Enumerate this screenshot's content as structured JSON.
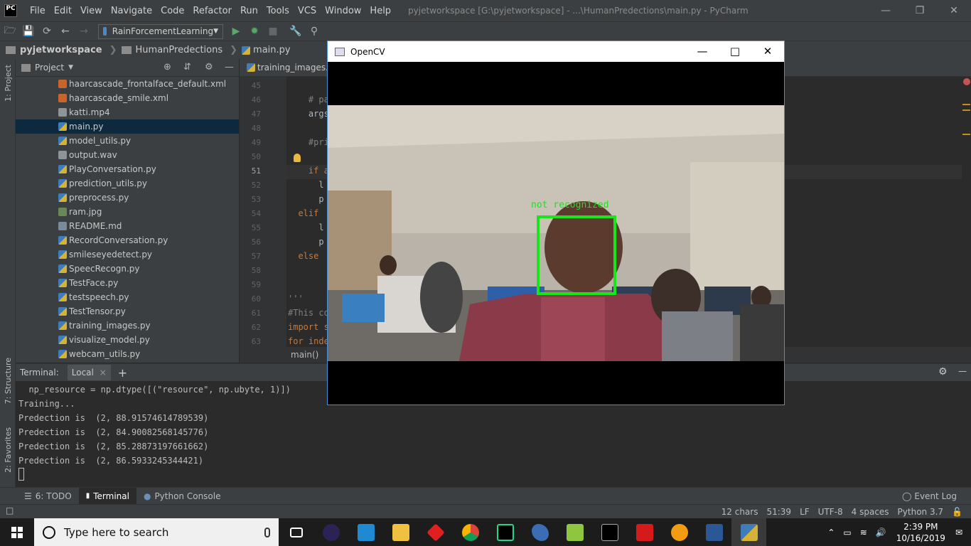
{
  "titlebar": {
    "logo_text": "PC",
    "menu": [
      "File",
      "Edit",
      "View",
      "Navigate",
      "Code",
      "Refactor",
      "Run",
      "Tools",
      "VCS",
      "Window",
      "Help"
    ],
    "window_title": "pyjetworkspace [G:\\pyjetworkspace] - ...\\HumanPredections\\main.py - PyCharm"
  },
  "toolbar": {
    "run_config": "RainForcementLearning"
  },
  "breadcrumb": [
    "pyjetworkspace",
    "HumanPredections",
    "main.py"
  ],
  "left_strip": {
    "project_tab": "1: Project",
    "structure_tab": "7: Structure",
    "favorites_tab": "2: Favorites"
  },
  "project": {
    "header": "Project",
    "files": [
      {
        "name": "haarcascade_frontalface_default.xml",
        "type": "xml"
      },
      {
        "name": "haarcascade_smile.xml",
        "type": "xml"
      },
      {
        "name": "katti.mp4",
        "type": "media"
      },
      {
        "name": "main.py",
        "type": "py",
        "selected": true
      },
      {
        "name": "model_utils.py",
        "type": "py"
      },
      {
        "name": "output.wav",
        "type": "media"
      },
      {
        "name": "PlayConversation.py",
        "type": "py"
      },
      {
        "name": "prediction_utils.py",
        "type": "py"
      },
      {
        "name": "preprocess.py",
        "type": "py"
      },
      {
        "name": "ram.jpg",
        "type": "img"
      },
      {
        "name": "README.md",
        "type": "md"
      },
      {
        "name": "RecordConversation.py",
        "type": "py"
      },
      {
        "name": "smileseyedetect.py",
        "type": "py"
      },
      {
        "name": "SpeecRecogn.py",
        "type": "py"
      },
      {
        "name": "TestFace.py",
        "type": "py"
      },
      {
        "name": "testspeech.py",
        "type": "py"
      },
      {
        "name": "TestTensor.py",
        "type": "py"
      },
      {
        "name": "training_images.py",
        "type": "py"
      },
      {
        "name": "visualize_model.py",
        "type": "py"
      },
      {
        "name": "webcam_utils.py",
        "type": "py"
      }
    ]
  },
  "editor": {
    "tab": "training_images.py",
    "line_numbers": [
      "45",
      "46",
      "47",
      "48",
      "49",
      "50",
      "51",
      "52",
      "53",
      "54",
      "55",
      "56",
      "57",
      "58",
      "59",
      "60",
      "61",
      "62",
      "63"
    ],
    "lines": [
      {
        "text": "",
        "cls": ""
      },
      {
        "text": "    # pa",
        "cls": "cm"
      },
      {
        "text": "    args",
        "cls": ""
      },
      {
        "text": "",
        "cls": ""
      },
      {
        "text": "    #pri",
        "cls": "cm"
      },
      {
        "text": "",
        "cls": ""
      },
      {
        "text": "    if a",
        "cls": "kw"
      },
      {
        "text": "      l",
        "cls": ""
      },
      {
        "text": "      p",
        "cls": ""
      },
      {
        "text": "  elif",
        "cls": "kw"
      },
      {
        "text": "      l",
        "cls": ""
      },
      {
        "text": "      p",
        "cls": ""
      },
      {
        "text": "  else",
        "cls": "kw"
      },
      {
        "text": "",
        "cls": ""
      },
      {
        "text": "",
        "cls": ""
      },
      {
        "text": "'''",
        "cls": "cm"
      },
      {
        "text": "#This co",
        "cls": "cm"
      },
      {
        "text": "import s",
        "cls": "kw"
      },
      {
        "text": "for inde",
        "cls": "kw"
      }
    ],
    "function_breadcrumb": "main()"
  },
  "terminal": {
    "label": "Terminal:",
    "tab": "Local",
    "lines": [
      "  np_resource = np.dtype([(\"resource\", np.ubyte, 1)])",
      "Training...",
      "Predection is  (2, 88.91574614789539)",
      "Predection is  (2, 84.90082568145776)",
      "Predection is  (2, 85.28873197661662)",
      "Predection is  (2, 86.5933245344421)"
    ]
  },
  "bottom_tabs": {
    "todo": "6: TODO",
    "terminal": "Terminal",
    "python_console": "Python Console",
    "event_log": "Event Log"
  },
  "statusbar": {
    "chars": "12 chars",
    "position": "51:39",
    "line_sep": "LF",
    "encoding": "UTF-8",
    "indent": "4 spaces",
    "interpreter": "Python 3.7"
  },
  "opencv": {
    "title": "OpenCV",
    "face_label": "not recognized",
    "box_color": "#17e617"
  },
  "taskbar": {
    "search_placeholder": "Type here to search",
    "time": "2:39 PM",
    "date": "10/16/2019"
  }
}
